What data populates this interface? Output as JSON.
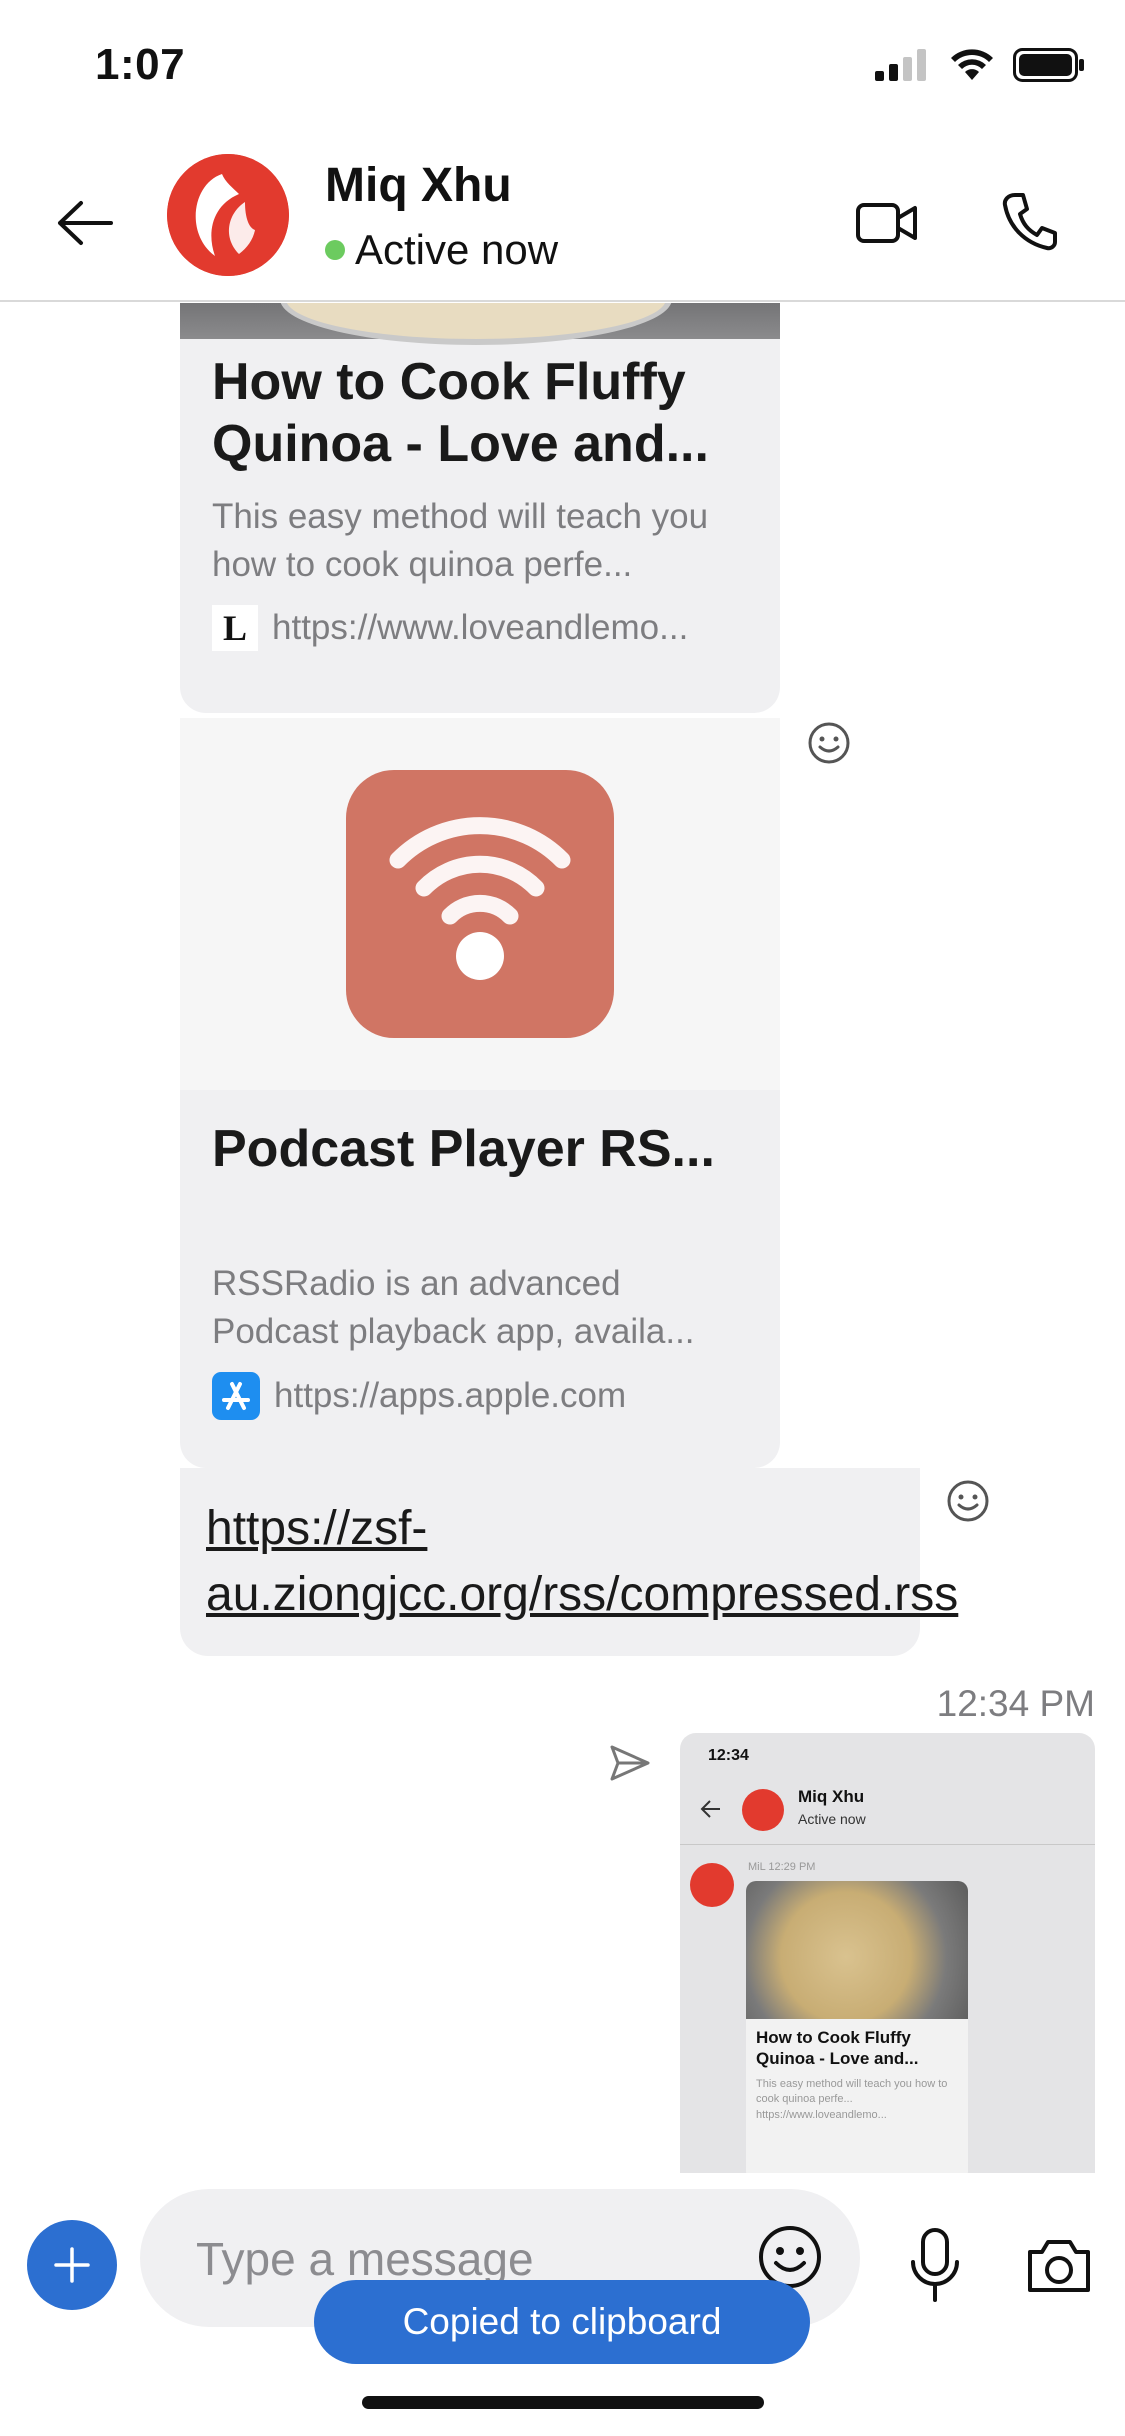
{
  "status_bar": {
    "time": "1:07",
    "icons": [
      "signal-icon",
      "wifi-icon",
      "battery-icon"
    ]
  },
  "header": {
    "back_icon": "arrow-left-icon",
    "contact_name": "Miq Xhu",
    "presence": "Active now",
    "presence_color": "#6ccb5f",
    "actions": [
      "video-call-icon",
      "phone-icon"
    ]
  },
  "messages": {
    "card1": {
      "title": "How to Cook Fluffy Quinoa - Love and...",
      "description": "This easy method will teach you how to cook quinoa perfe...",
      "url": "https://www.loveandlemo...",
      "site_logo_letter": "L"
    },
    "card2": {
      "title": "Podcast Player RS...",
      "description": "RSSRadio is an advanced Podcast playback app, availa...",
      "url": "https://apps.apple.com",
      "icon_color": "#d07564"
    },
    "link": {
      "text": "https://zsf-au.ziongjcc.org/rss/compressed.rss"
    },
    "sent": {
      "timestamp": "12:34 PM",
      "thumb": {
        "time": "12:34",
        "name": "Miq Xhu",
        "presence": "Active now",
        "sender_line": "MiL 12:29 PM",
        "title": "How to Cook Fluffy Quinoa - Love and...",
        "description": "This easy method will teach you how to cook quinoa perfe...",
        "url": "https://www.loveandlemo..."
      }
    }
  },
  "composer": {
    "placeholder": "Type a message",
    "accent": "#2c6fd1"
  },
  "toast": {
    "text": "Copied to clipboard"
  }
}
